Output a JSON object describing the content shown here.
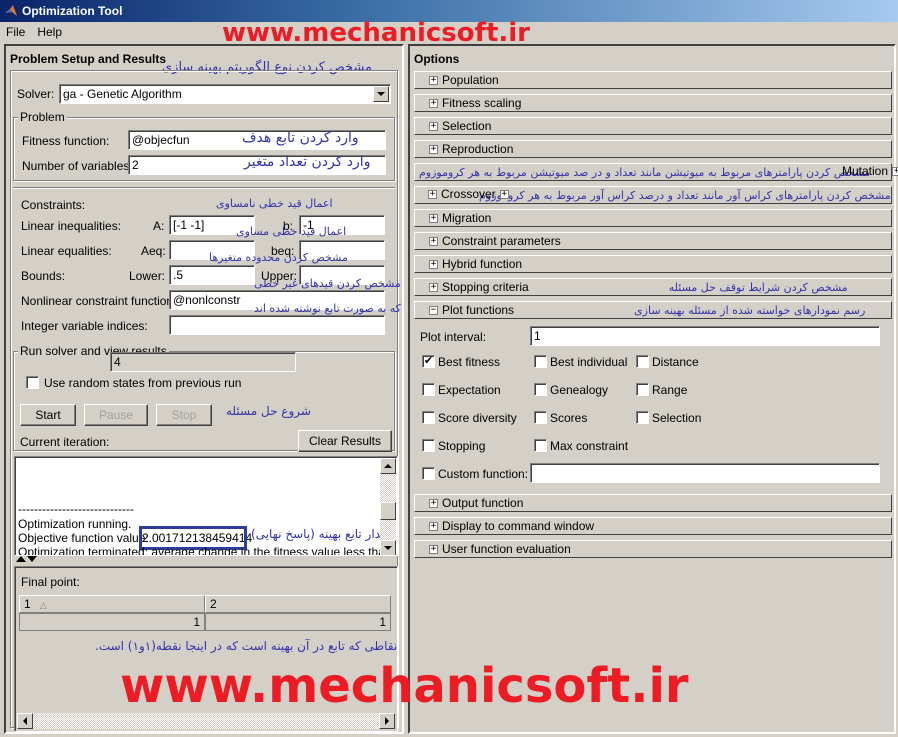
{
  "window": {
    "title": "Optimization Tool"
  },
  "menu": [
    {
      "label": "File"
    },
    {
      "label": "Help"
    }
  ],
  "watermark": {
    "text": "www.mechanicsoft.ir"
  },
  "left": {
    "title": "Problem Setup and Results",
    "annotation_solver": "مشخص کردن نوع الگوریتم بهینه سازی",
    "solver": {
      "label": "Solver:",
      "value": "ga - Genetic Algorithm"
    },
    "problem": {
      "group_label": "Problem",
      "fitness_label": "Fitness function:",
      "fitness_value": "@objecfun",
      "fitness_note": "وارد کردن تابع هدف",
      "nvars_label": "Number of variables:",
      "nvars_value": "2",
      "nvars_note": "وارد کردن تعداد متغیر"
    },
    "constraints": {
      "title": "Constraints:",
      "lin_ineq_label": "Linear inequalities:",
      "A_label": "A:",
      "A_value": "[-1 -1]",
      "b_label": "b:",
      "b_value": "-1",
      "lin_ineq_note": "اعمال قید خطی نامساوی",
      "lin_eq_label": "Linear equalities:",
      "Aeq_label": "Aeq:",
      "Aeq_value": "",
      "beq_label": "beq:",
      "beq_value": "",
      "lin_eq_note": "اعمال قید خطی مساوی",
      "bounds_label": "Bounds:",
      "lower_label": "Lower:",
      "lower_value": ".5",
      "upper_label": "Upper:",
      "upper_value": "",
      "bounds_note": "مشخص کردن محدوده متغیرها",
      "nonlin_label": "Nonlinear constraint function:",
      "nonlin_value": "@nonlconstr",
      "nonlin_note1": "مشخص کردن قیدهای غیر خطی",
      "nonlin_note2": "که به صورت تابع نوشته شده اند",
      "intcon_label": "Integer variable indices:",
      "intcon_value": ""
    },
    "run": {
      "group_label": "Run solver and view results",
      "random_states_label": "Use random states from previous run",
      "random_states_checked": false,
      "start_label": "Start",
      "pause_label": "Pause",
      "stop_label": "Stop",
      "start_note": "شروع حل مسئله",
      "iteration_label": "Current iteration:",
      "iteration_value": "4",
      "clear_label": "Clear Results"
    },
    "log": {
      "separator": "-----------------------------",
      "running": "Optimization running.",
      "objective_label": "Objective function value:",
      "objective_value": "2.001712138459414",
      "objective_note": "مقدار تابع بهینه (پاسخ نهایی)",
      "terminated": "Optimization terminated: average change in the fitness value less than"
    },
    "final_point": {
      "label": "Final point:",
      "columns": [
        "1",
        "2"
      ],
      "values": [
        "1",
        "1"
      ],
      "note": "نقاطی که تابع در آن بهینه است که در اینجا نقطه(۱و۱) است."
    }
  },
  "right": {
    "title": "Options",
    "sections": [
      {
        "label": "Population",
        "expanded": false,
        "note": ""
      },
      {
        "label": "Fitness scaling",
        "expanded": false,
        "note": ""
      },
      {
        "label": "Selection",
        "expanded": false,
        "note": ""
      },
      {
        "label": "Reproduction",
        "expanded": false,
        "note": ""
      },
      {
        "label": "Mutation",
        "expanded": false,
        "note": "مشخص کردن پارامترهای مربوط به میوتیشن مانند تعداد و در صد میوتیشن مربوط به هر کروموزوم"
      },
      {
        "label": "Crossover",
        "expanded": false,
        "note": "مشخص کردن پارامترهای کراس آور مانند تعداد و درصد کراس آور مربوط به هر کروموزوم"
      },
      {
        "label": "Migration",
        "expanded": false,
        "note": ""
      },
      {
        "label": "Constraint parameters",
        "expanded": false,
        "note": ""
      },
      {
        "label": "Hybrid function",
        "expanded": false,
        "note": ""
      },
      {
        "label": "Stopping criteria",
        "expanded": false,
        "note": "مشخص کردن شرایط توقف حل مسئله"
      },
      {
        "label": "Plot functions",
        "expanded": true,
        "note": "رسم نمودارهای خواسته شده از مسئله بهینه سازی"
      },
      {
        "label": "Output function",
        "expanded": false,
        "note": ""
      },
      {
        "label": "Display to command window",
        "expanded": false,
        "note": ""
      },
      {
        "label": "User function evaluation",
        "expanded": false,
        "note": ""
      }
    ],
    "plot": {
      "interval_label": "Plot interval:",
      "interval_value": "1",
      "checkboxes": [
        {
          "label": "Best fitness",
          "checked": true
        },
        {
          "label": "Best individual",
          "checked": false
        },
        {
          "label": "Distance",
          "checked": false
        },
        {
          "label": "Expectation",
          "checked": false
        },
        {
          "label": "Genealogy",
          "checked": false
        },
        {
          "label": "Range",
          "checked": false
        },
        {
          "label": "Score diversity",
          "checked": false
        },
        {
          "label": "Scores",
          "checked": false
        },
        {
          "label": "Selection",
          "checked": false
        },
        {
          "label": "Stopping",
          "checked": false
        },
        {
          "label": "Max constraint",
          "checked": false
        }
      ],
      "custom_label": "Custom function:",
      "custom_checked": false,
      "custom_value": ""
    }
  }
}
